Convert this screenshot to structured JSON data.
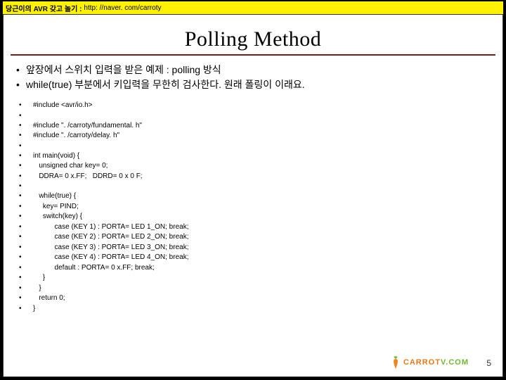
{
  "header": {
    "text": "당근이의 AVR 갖고 놀기  :  ",
    "url": "http: //naver. com/carroty"
  },
  "title": "Polling Method",
  "bullets": [
    "앞장에서 스위치 입력을 받은 예제 : polling 방식",
    "while(true) 부분에서 키입력을 무한히 검사한다. 원래 폴링이 이래요."
  ],
  "code": [
    "#include <avr/io.h>",
    "",
    "#include \". /carroty/fundamental. h\"",
    "#include \". /carroty/delay. h\"",
    "",
    "int main(void) {",
    "   unsigned char key= 0;",
    "   DDRA= 0 x.FF;   DDRD= 0 x 0 F;",
    "",
    "   while(true) {",
    "     key= PIND;",
    "     switch(key) {",
    "           case (KEY 1) : PORTA= LED 1_ON; break;",
    "           case (KEY 2) : PORTA= LED 2_ON; break;",
    "           case (KEY 3) : PORTA= LED 3_ON; break;",
    "           case (KEY 4) : PORTA= LED 4_ON; break;",
    "           default : PORTA= 0 x.FF; break;",
    "     }",
    "   }",
    "   return 0;",
    "}"
  ],
  "logo": {
    "text1": "CARROT",
    "text2": "V.COM"
  },
  "page": "5"
}
